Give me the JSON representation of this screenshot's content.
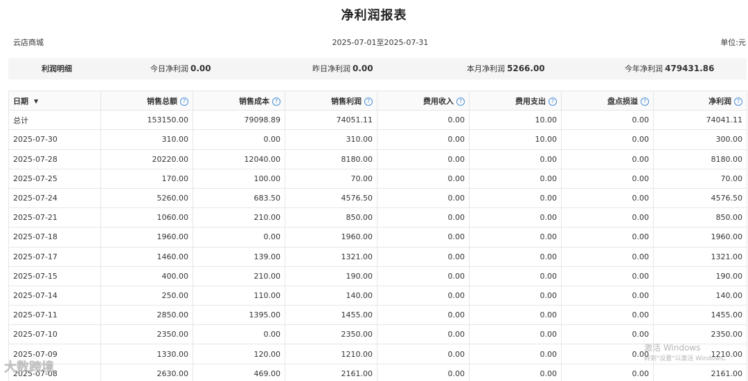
{
  "title": "净利润报表",
  "meta": {
    "shop": "云店商城",
    "range": "2025-07-01至2025-07-31",
    "unit": "单位:元"
  },
  "summary": {
    "label": "利润明细",
    "today_label": "今日净利润",
    "today_value": "0.00",
    "yesterday_label": "昨日净利润",
    "yesterday_value": "0.00",
    "month_label": "本月净利润",
    "month_value": "5266.00",
    "year_label": "今年净利润",
    "year_value": "479431.86"
  },
  "table": {
    "columns": [
      "日期",
      "销售总额",
      "销售成本",
      "销售利润",
      "费用收入",
      "费用支出",
      "盘点损溢",
      "净利润"
    ],
    "rows": [
      [
        "总计",
        "153150.00",
        "79098.89",
        "74051.11",
        "0.00",
        "10.00",
        "0.00",
        "74041.11"
      ],
      [
        "2025-07-30",
        "310.00",
        "0.00",
        "310.00",
        "0.00",
        "10.00",
        "0.00",
        "300.00"
      ],
      [
        "2025-07-28",
        "20220.00",
        "12040.00",
        "8180.00",
        "0.00",
        "0.00",
        "0.00",
        "8180.00"
      ],
      [
        "2025-07-25",
        "170.00",
        "100.00",
        "70.00",
        "0.00",
        "0.00",
        "0.00",
        "70.00"
      ],
      [
        "2025-07-24",
        "5260.00",
        "683.50",
        "4576.50",
        "0.00",
        "0.00",
        "0.00",
        "4576.50"
      ],
      [
        "2025-07-21",
        "1060.00",
        "210.00",
        "850.00",
        "0.00",
        "0.00",
        "0.00",
        "850.00"
      ],
      [
        "2025-07-18",
        "1960.00",
        "0.00",
        "1960.00",
        "0.00",
        "0.00",
        "0.00",
        "1960.00"
      ],
      [
        "2025-07-17",
        "1460.00",
        "139.00",
        "1321.00",
        "0.00",
        "0.00",
        "0.00",
        "1321.00"
      ],
      [
        "2025-07-15",
        "400.00",
        "210.00",
        "190.00",
        "0.00",
        "0.00",
        "0.00",
        "190.00"
      ],
      [
        "2025-07-14",
        "250.00",
        "110.00",
        "140.00",
        "0.00",
        "0.00",
        "0.00",
        "140.00"
      ],
      [
        "2025-07-11",
        "2850.00",
        "1395.00",
        "1455.00",
        "0.00",
        "0.00",
        "0.00",
        "1455.00"
      ],
      [
        "2025-07-10",
        "2350.00",
        "0.00",
        "2350.00",
        "0.00",
        "0.00",
        "0.00",
        "2350.00"
      ],
      [
        "2025-07-09",
        "1330.00",
        "120.00",
        "1210.00",
        "0.00",
        "0.00",
        "0.00",
        "1210.00"
      ],
      [
        "2025-07-08",
        "2630.00",
        "469.00",
        "2161.00",
        "0.00",
        "0.00",
        "0.00",
        "2161.00"
      ]
    ]
  },
  "watermark": {
    "windows_line1": "激活 Windows",
    "windows_line2": "转到\"设置\"以激活 Windows。",
    "brand": "大数跨境"
  },
  "icons": {
    "help": "question-circle-icon",
    "sort": "caret-down-icon"
  },
  "colors": {
    "accent": "#4a8fd8",
    "header_bg": "#fafafa",
    "summary_bg": "#f5f5f5"
  }
}
